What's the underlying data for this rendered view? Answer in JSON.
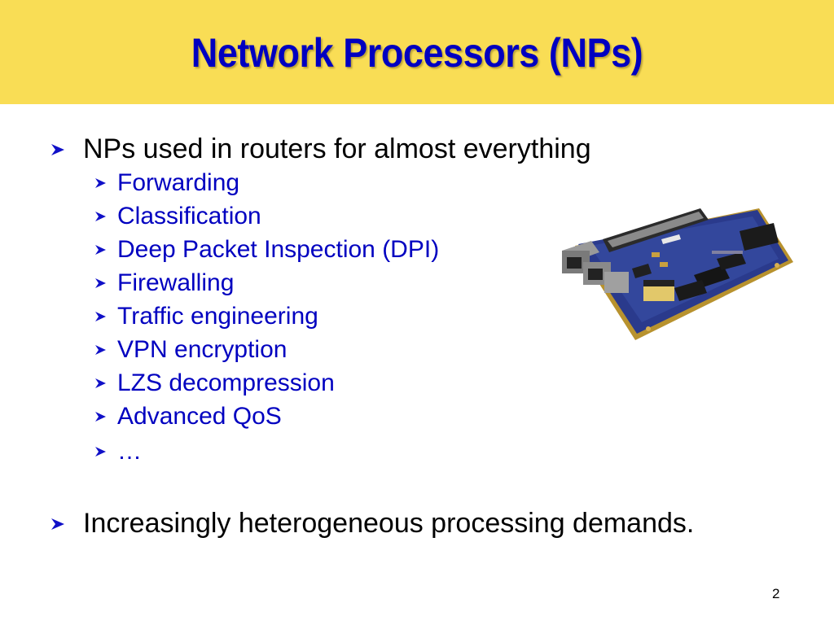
{
  "slide": {
    "title": "Network Processors (NPs)",
    "bullets": [
      {
        "text": "NPs used in routers for almost everything",
        "sub_bullets": [
          "Forwarding",
          "Classification",
          "Deep Packet Inspection (DPI)",
          "Firewalling",
          "Traffic engineering",
          "VPN encryption",
          "LZS decompression",
          "Advanced QoS",
          "…"
        ]
      },
      {
        "text": "Increasingly heterogeneous processing demands."
      }
    ],
    "image": {
      "icon": "network-processor-board-image"
    },
    "page_number": "2"
  },
  "colors": {
    "title_background": "#f9dd55",
    "title_text": "#0000c0",
    "sub_bullet_text": "#0000c0",
    "bullet_arrow": "#1010c8",
    "body_text": "#000000"
  }
}
